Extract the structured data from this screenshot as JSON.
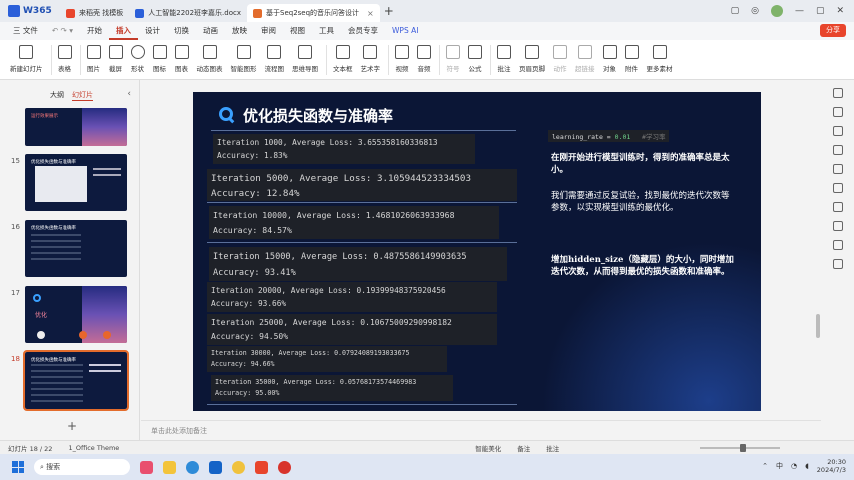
{
  "titlebar": {
    "brand": "W365",
    "tabs": [
      {
        "label": "来稻壳 找模板",
        "icon_color": "#e8452c"
      },
      {
        "label": "人工智能2202班李嘉乐.docx",
        "icon_color": "#2b5fd9"
      },
      {
        "label": "基于Seq2seq的音乐问答设计",
        "icon_color": "#e36c2c"
      }
    ],
    "new_tab": "+"
  },
  "menubar": {
    "file": "三 文件",
    "items": [
      "开始",
      "插入",
      "设计",
      "切换",
      "动画",
      "放映",
      "审阅",
      "视图",
      "工具",
      "会员专享"
    ],
    "active": "插入",
    "wps_ai": "WPS AI",
    "share": "分享"
  },
  "ribbon": {
    "buttons": [
      "新建幻灯片",
      "表格",
      "图片",
      "截屏",
      "形状",
      "图标",
      "图表",
      "动态图表",
      "智能图形",
      "流程图",
      "思维导图",
      "文本框",
      "艺术字",
      "视频",
      "音频",
      "符号",
      "公式",
      "批注",
      "页眉页脚",
      "动作",
      "超链接",
      "对象",
      "附件",
      "更多素材"
    ]
  },
  "leftpanel": {
    "tabs": [
      "大纲",
      "幻灯片"
    ],
    "active_tab": "幻灯片",
    "thumbs": [
      {
        "num": "",
        "title": "运行效果展示"
      },
      {
        "num": "15",
        "title": "优化损失函数与准确率"
      },
      {
        "num": "16",
        "title": "优化损失函数与准确率"
      },
      {
        "num": "17",
        "title": "优化"
      },
      {
        "num": "18",
        "title": "优化损失函数与准确率"
      }
    ],
    "add": "+"
  },
  "slide": {
    "title": "优化损失函数与准确率",
    "logs": [
      {
        "iter": "Iteration 1000, Average Loss: 3.655358160336813",
        "acc": "Accuracy: 1.83%"
      },
      {
        "iter": "Iteration 5000, Average Loss: 3.105944523334503",
        "acc": "Accuracy: 12.84%"
      },
      {
        "iter": "Iteration 10000, Average Loss: 1.4681026063933968",
        "acc": "Accuracy: 84.57%"
      },
      {
        "iter": "Iteration 15000, Average Loss: 0.4875586149903635",
        "acc": "Accuracy: 93.41%"
      },
      {
        "iter": "Iteration 20000, Average Loss: 0.19399948375920456",
        "acc": "Accuracy: 93.66%"
      },
      {
        "iter": "Iteration 25000, Average Loss: 0.10675009290998182",
        "acc": "Accuracy: 94.50%"
      },
      {
        "iter": "Iteration 30000, Average Loss: 0.07924089193033675",
        "acc": "Accuracy: 94.66%"
      },
      {
        "iter": "Iteration 35000, Average Loss: 0.05768173574469983",
        "acc": "Accuracy: 95.00%"
      }
    ],
    "lr_code": "learning_rate = ",
    "lr_value": "0.01",
    "lr_comment": "#学习率",
    "note1": "在刚开始进行模型训练时，得到的准确率总是太小。",
    "note2": "我们需要通过反复试验，找到最优的迭代次数等参数，以实现模型训练的最优化。",
    "note3": "增加hidden_size（隐藏层）的大小，同时增加迭代次数，从而得到最优的损失函数和准确率。"
  },
  "notes_placeholder": "单击此处添加备注",
  "statusbar": {
    "slide_info": "幻灯片 18 / 22",
    "theme": "1_Office Theme",
    "smart": "智能美化",
    "notes": "备注",
    "comments": "批注"
  },
  "taskbar": {
    "search": "搜索",
    "time": "20:30",
    "date": "2024/7/3",
    "lang": "中"
  }
}
